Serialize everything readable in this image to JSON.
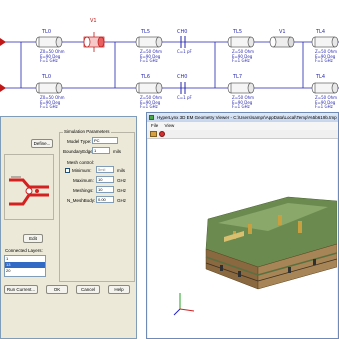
{
  "schematic": {
    "top_row": [
      {
        "name": "TL0",
        "lines": [
          "Z0=50 Ohm",
          "E=90 Deg",
          "F=1 GHz"
        ]
      },
      {
        "name": "V1",
        "lines": []
      },
      {
        "name": "TL5",
        "lines": [
          "Z=50 Ohm",
          "E=90 Deg",
          "F=1 GHz"
        ]
      },
      {
        "name": "CH0",
        "lines": [
          "C=1 pF"
        ]
      },
      {
        "name": "TL5",
        "lines": [
          "Z=50 Ohm",
          "E=90 Deg",
          "F=1 GHz"
        ]
      },
      {
        "name": "V1",
        "lines": []
      },
      {
        "name": "TL4",
        "lines": [
          "Z=50 Ohm",
          "E=90 Deg",
          "F=1 GHz"
        ]
      }
    ],
    "bottom_row": [
      {
        "name": "TL0",
        "lines": [
          "Z0=50 Ohm",
          "E=90 Deg",
          "F=1 GHz"
        ]
      },
      {
        "name": "TL6",
        "lines": [
          "Z=50 Ohm",
          "E=90 Deg",
          "F=1 GHz"
        ]
      },
      {
        "name": "CH0",
        "lines": [
          "C=1 pF"
        ]
      },
      {
        "name": "TL7",
        "lines": [
          "Z=50 Ohm",
          "E=90 Deg",
          "F=1 GHz"
        ]
      },
      {
        "name": "TL4",
        "lines": [
          "Z=50 Ohm",
          "E=90 Deg",
          "F=1 GHz"
        ]
      }
    ]
  },
  "dialog": {
    "group_title": "Simulation Parameters",
    "model_type_label": "Model Type:",
    "model_type_value": "PC",
    "boundary_label": "BoundaryEdges",
    "boundary_value": "1",
    "boundary_unit": "mils",
    "mesh_label": "Mesh control:",
    "min_label": "Minimum:",
    "min_value": "5mil",
    "min_unit": "mils",
    "max_label": "Maximum:",
    "max_value": "10",
    "max_unit": "GHz",
    "meshings_label": "Meshings:",
    "meshings_value": "10",
    "meshings_unit": "GHz",
    "n_label": "N_MeshBody:",
    "n_value": "0.00",
    "n_unit": "GHz",
    "define_button": "Define...",
    "edit_button": "Edit",
    "layers_label": "Connected Layers:",
    "layers": [
      "1",
      "13",
      "20"
    ],
    "run_button": "Run Current...",
    "ok_button": "OK",
    "cancel_button": "Cancel",
    "help_button": "Help"
  },
  "viewer": {
    "title": "HyperLynx 3D EM Geometry Viewer - C:\\Users\\sampr\\AppData\\Local\\Temp\\%5b619b.tmp",
    "menu": [
      "File",
      "View"
    ],
    "axis_labels": [
      "x",
      "y",
      "z"
    ]
  },
  "colors": {
    "wire": "#2323b0",
    "schematic_text": "#2b2bb0",
    "component_red": "#d32020",
    "board_green": "#6b8a4f",
    "board_brown": "#8a6840",
    "dialog_bg": "#ece9d8",
    "highlight": "#316ac5"
  }
}
